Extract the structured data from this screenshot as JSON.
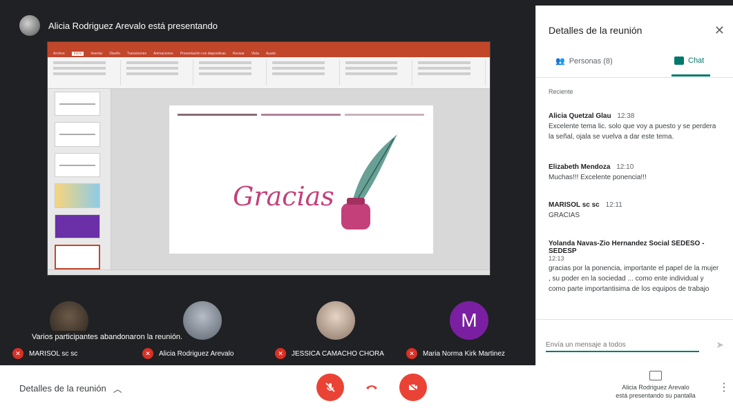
{
  "presenter": {
    "banner": "Alicia Rodriguez Arevalo está presentando"
  },
  "slide": {
    "text": "Gracias",
    "ppt_tabs": [
      "Archivo",
      "Inicio",
      "Insertar",
      "Diseño",
      "Transiciones",
      "Animaciones",
      "Presentación con diapositivas",
      "Revisar",
      "Vista",
      "Ayuda"
    ]
  },
  "participants": [
    {
      "name": "MARISOL sc sc"
    },
    {
      "name": "Alicia Rodriguez Arevalo"
    },
    {
      "name": "JESSICA CAMACHO CHORA"
    },
    {
      "name": "Maria Norma Kirk Martinez",
      "initial": "M"
    }
  ],
  "toast": "Varios participantes abandonaron la reunión.",
  "panel": {
    "title": "Detalles de la reunión",
    "tab_people": "Personas (8)",
    "tab_chat": "Chat",
    "section_label": "Reciente",
    "messages": [
      {
        "author": "Alicia Quetzal Glau",
        "time": "12:38",
        "text": "Excelente tema lic. solo que voy a puesto y se perdera la señal, ojala se vuelva a dar este tema."
      },
      {
        "author": "Elizabeth Mendoza",
        "time": "12:10",
        "text": "Muchas!!! Excelente ponencia!!!"
      },
      {
        "author": "MARISOL sc sc",
        "time": "12:11",
        "text": "GRACIAS"
      },
      {
        "author": "Yolanda Navas-Zio Hernandez Social SEDESO - SEDESP",
        "time": "12:13",
        "text": "gracias por la ponencia, importante el papel de la mujer , su poder en la sociedad ... como ente individual y como parte importantisima de los equipos de trabajo"
      }
    ],
    "input_placeholder": "Envía un mensaje a todos"
  },
  "bottom": {
    "details_label": "Detalles de la reunión",
    "presenting_line1": "Alicia Rodriguez Arevalo",
    "presenting_line2": "está presentando su pantalla"
  },
  "colors": {
    "accent": "#00796b",
    "danger": "#ea4335",
    "stage": "#202124",
    "ppt": "#c2462a",
    "avatar_purple": "#7b1fa2"
  }
}
